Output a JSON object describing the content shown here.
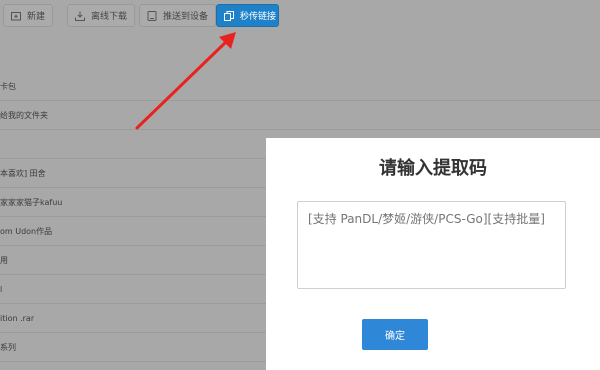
{
  "toolbar": {
    "new_label": "新建",
    "offline_label": "离线下载",
    "push_label": "推送到设备",
    "flash_link_label": "秒传链接"
  },
  "file_list": [
    "卡包",
    "给我的文件夹",
    "",
    "本喜欢] 田舍",
    "家家家猫子kafuu",
    "om Udon作品",
    "用",
    "l",
    "ition .rar",
    "系列"
  ],
  "dialog": {
    "title": "请输入提取码",
    "input_placeholder": "[支持 PanDL/梦姬/游侠/PCS-Go][支持批量]",
    "confirm_label": "确定"
  },
  "colors": {
    "overlay": "#a8a8a8",
    "primary_button": "#1f82c9",
    "confirm_button": "#2f87d8",
    "annotation_arrow": "#e8231f"
  }
}
